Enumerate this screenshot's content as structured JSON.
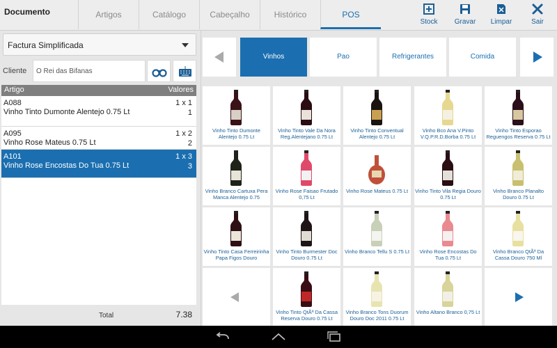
{
  "header": {
    "title": "Documento",
    "tabs": [
      {
        "label": "Artigos"
      },
      {
        "label": "Catálogo"
      },
      {
        "label": "Cabeçalho"
      },
      {
        "label": "Histórico"
      },
      {
        "label": "POS"
      }
    ],
    "actions": [
      {
        "label": "Stock",
        "icon": "stock-icon"
      },
      {
        "label": "Gravar",
        "icon": "save-icon"
      },
      {
        "label": "Limpar",
        "icon": "clear-icon"
      },
      {
        "label": "Sair",
        "icon": "close-icon"
      }
    ]
  },
  "document": {
    "type_selected": "Factura Simplificada",
    "client_label": "Cliente",
    "client_value": "O Rei das Bifanas"
  },
  "lines": {
    "header": {
      "article": "Artigo",
      "values": "Valores"
    },
    "rows": [
      {
        "code": "A088",
        "description": "Vinho Tinto Dumonte Alentejo 0.75 Lt",
        "qty": "1 x 1",
        "value": "1"
      },
      {
        "code": "A095",
        "description": "Vinho Rose Mateus 0.75 Lt",
        "qty": "1 x 2",
        "value": "2"
      },
      {
        "code": "A101",
        "description": "Vinho Rose Encostas Do Tua 0.75 Lt",
        "qty": "1 x 3",
        "value": "3"
      }
    ],
    "total_label": "Total",
    "total_value": "7.38"
  },
  "categories": [
    {
      "label": "Vinhos"
    },
    {
      "label": "Pao"
    },
    {
      "label": "Refrigerantes"
    },
    {
      "label": "Comida"
    }
  ],
  "products": [
    {
      "name": "Vinho Tinto Dumonte Alentejo 0.75 Lt",
      "bottle": "#3a1218",
      "label": "#d8d0c4"
    },
    {
      "name": "Vinho Tinto Vale Da Nora Reg.Alentejano 0.75 Lt",
      "bottle": "#2a0c12",
      "label": "#e8e2d8"
    },
    {
      "name": "Vinho Tinto Conventual Alentejo 0.75 Lt",
      "bottle": "#1a1410",
      "label": "#c8a050"
    },
    {
      "name": "Vinho Bco Ana V.Pinto V.Q.P.R.D.Borba 0.75 Lt",
      "bottle": "#e6d890",
      "label": "#f4f0e2"
    },
    {
      "name": "Vinho Tinto Esporao Reguengos Reserva 0.75 Lt",
      "bottle": "#2a0e1a",
      "label": "#d8c8a0"
    },
    {
      "name": "Vinho Branco Cartuxa Pera Manca Alentejo 0.75",
      "bottle": "#1e2218",
      "label": "#e8e4d8"
    },
    {
      "name": "Vinho Rose Faisao Frutado 0,75 Lt",
      "bottle": "#e04a6a",
      "label": "#f2f2f2"
    },
    {
      "name": "Vinho Rose Mateus 0.75 Lt",
      "bottle": "#c0503a",
      "label": "#e8d8b0"
    },
    {
      "name": "Vinho Tinto Vila Regia Douro 0.75 Lt",
      "bottle": "#2a0e14",
      "label": "#e4e0d8"
    },
    {
      "name": "Vinho Branco Planalto Douro 0.75 Lt",
      "bottle": "#c8c070",
      "label": "#f0ecd8"
    },
    {
      "name": "Vinho Tinto Casa Ferreirinha Papa Figos Douro",
      "bottle": "#2e1014",
      "label": "#ece6da"
    },
    {
      "name": "Vinho Tinto Burmester Doc Douro 0.75 Lt",
      "bottle": "#1e1416",
      "label": "#e0dcd4"
    },
    {
      "name": "Vinho Branco Tellu S 0.75 Lt",
      "bottle": "#c8d0b8",
      "label": "#f4f4f0"
    },
    {
      "name": "Vinho Rose Encostas Do Tua 0.75 Lt",
      "bottle": "#e88a90",
      "label": "#f6f0f0"
    },
    {
      "name": "Vinho Branco QtÃª Da Cassa Douro 750 Ml",
      "bottle": "#e8e0a0",
      "label": "#f8f6ee"
    },
    {
      "name": "Vinho Tinto QtÃª Da Cassa Reserva Douro 0.75 Lt",
      "bottle": "#3a0c14",
      "label": "#c02828"
    },
    {
      "name": "Vinho Branco Tons Duorum Douro Doc 2011 0.75 Lt",
      "bottle": "#e8e4b0",
      "label": "#f6f2e4"
    },
    {
      "name": "Vinho Altano Branco 0,75 Lt",
      "bottle": "#d8d49a",
      "label": "#f2f0e6"
    }
  ],
  "colors": {
    "accent": "#1b6fb0",
    "selected_row": "#1b6fb0",
    "nav_arrow_disabled": "#aaaaaa"
  }
}
